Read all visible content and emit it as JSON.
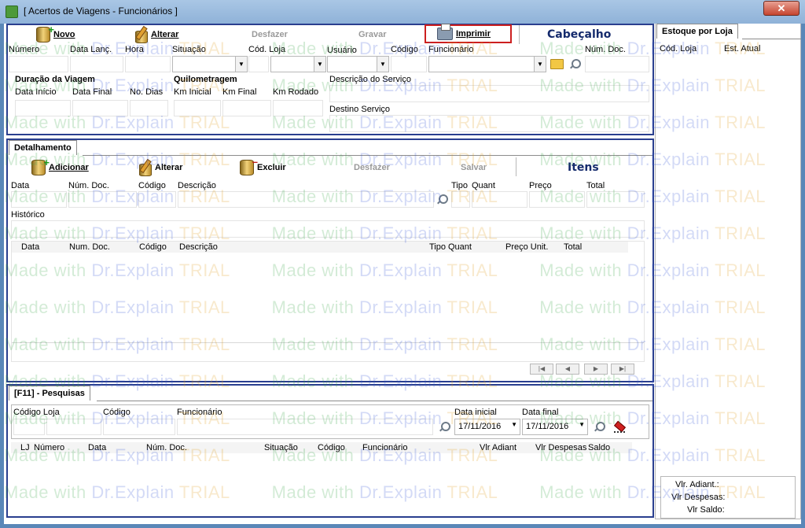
{
  "window": {
    "title": "[ Acertos de Viagens - Funcionários ]",
    "close_label": "✕"
  },
  "toolbar": {
    "novo": "Novo",
    "alterar": "Alterar",
    "desfazer": "Desfazer",
    "gravar": "Gravar",
    "imprimir": "Imprimir",
    "section": "Cabeçalho"
  },
  "header": {
    "numero": "Número",
    "data_lanc": "Data Lanç.",
    "hora": "Hora",
    "situacao": "Situação",
    "cod_loja": "Cód. Loja",
    "usuario": "Usuário",
    "codigo": "Código",
    "funcionario": "Funcionário",
    "num_doc": "Núm. Doc.",
    "duracao": "Duração da Viagem",
    "data_inicio": "Data Início",
    "data_final": "Data Final",
    "no_dias": "No. Dias",
    "quilometragem": "Quilometragem",
    "km_inicial": "Km Inicial",
    "km_final": "Km Final",
    "km_rodado": "Km Rodado",
    "descricao_servico": "Descrição do Serviço",
    "destino_servico": "Destino Serviço"
  },
  "detalhamento": {
    "tab": "Detalhamento",
    "adicionar": "Adicionar",
    "alterar": "Alterar",
    "excluir": "Excluir",
    "desfazer": "Desfazer",
    "salvar": "Salvar",
    "section": "Itens",
    "labels": {
      "data": "Data",
      "num_doc": "Núm. Doc.",
      "codigo": "Código",
      "descricao": "Descrição",
      "tipo": "Tipo",
      "quant": "Quant",
      "preco": "Preço",
      "total": "Total",
      "historico": "Histórico"
    },
    "grid_columns": [
      "Data",
      "Num. Doc.",
      "Código",
      "Descrição",
      "Tipo",
      "Quant",
      "Preço Unit.",
      "Total"
    ]
  },
  "pesquisas": {
    "tab": "[F11] - Pesquisas",
    "codigo_loja": "Código  Loja",
    "codigo": "Código",
    "funcionario": "Funcionário",
    "data_inicial_label": "Data inicial",
    "data_final_label": "Data final",
    "data_inicial": "17/11/2016",
    "data_final": "17/11/2016",
    "grid_columns": [
      "LJ",
      "Número",
      "Data",
      "Núm. Doc.",
      "Situação",
      "Código",
      "Funcionário",
      "Vlr Adiant",
      "Vlr Despesas",
      "Saldo"
    ]
  },
  "estoque": {
    "tab": "Estoque por Loja",
    "col_cod_loja": "Cód. Loja",
    "col_est_atual": "Est. Atual",
    "vlr_adiant": "Vlr. Adiant.:",
    "vlr_despesas": "Vlr Despesas:",
    "vlr_saldo": "Vlr Saldo:"
  },
  "watermark": {
    "text1": "Made with ",
    "text2": "Dr.Explain ",
    "text3": "TRIAL"
  },
  "colors": {
    "panel_border": "#2a3f8f",
    "highlight_border": "#cc1f1f",
    "section_title": "#142a6c"
  }
}
